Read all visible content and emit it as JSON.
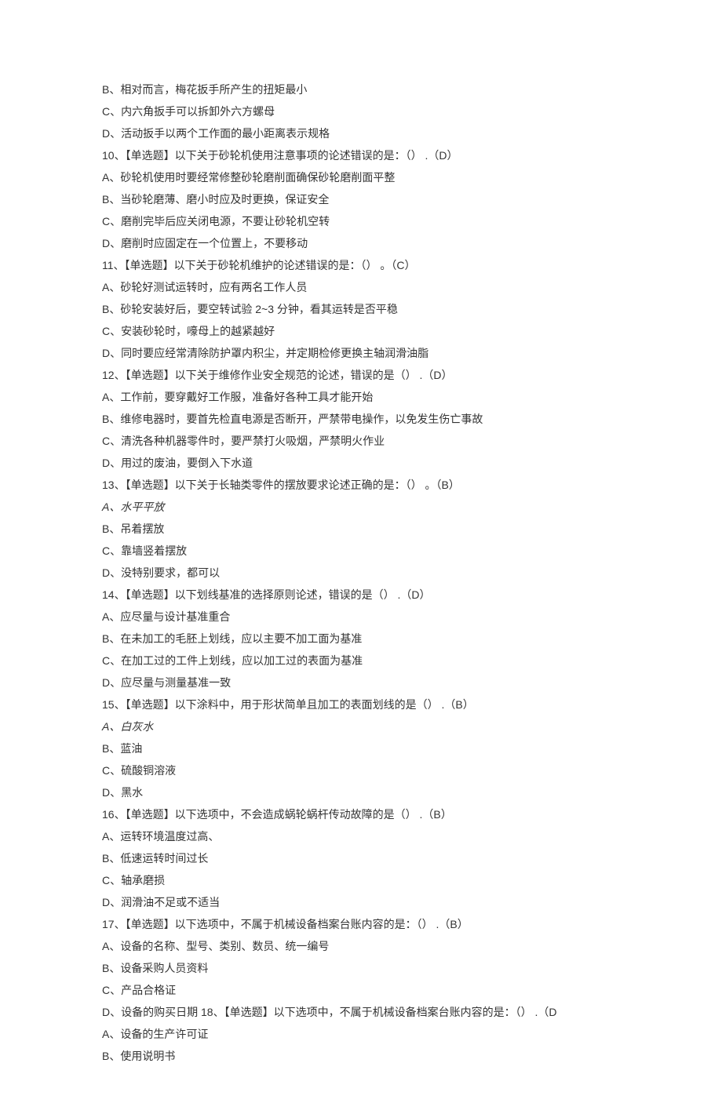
{
  "lines": [
    {
      "text": "B、相对而言，梅花扳手所产生的扭矩最小"
    },
    {
      "text": "C、内六角扳手可以拆卸外六方螺母"
    },
    {
      "text": "D、活动扳手以两个工作面的最小距离表示规格"
    },
    {
      "text": "10、【单选题】以下关于砂轮机使用注意事项的论述错误的是：（） .（D）"
    },
    {
      "text": "A、砂轮机使用时要经常修整砂轮磨削面确保砂轮磨削面平整"
    },
    {
      "text": "B、当砂轮磨薄、磨小时应及时更换，保证安全"
    },
    {
      "text": "C、磨削完毕后应关闭电源，不要让砂轮机空转"
    },
    {
      "text": "D、磨削时应固定在一个位置上，不要移动"
    },
    {
      "text": "11、【单选题】以下关于砂轮机维护的论述错误的是：（） 。（C）"
    },
    {
      "text": "A、砂轮好测试运转时，应有两名工作人员"
    },
    {
      "text": "B、砂轮安装好后，要空转试验 2~3 分钟，看其运转是否平稳"
    },
    {
      "text": "C、安装砂轮时，嚎母上的越紧越好"
    },
    {
      "text": "D、同时要应经常清除防护罩内积尘，并定期检修更换主轴润滑油脂"
    },
    {
      "text": "12、【单选题】以下关于维修作业安全规范的论述，错误的是（） .（D）"
    },
    {
      "text": "A、工作前，要穿戴好工作服，准备好各种工具才能开始"
    },
    {
      "text": "B、维修电器时，要首先检直电源是否断开，严禁带电操作，以免发生伤亡事故"
    },
    {
      "text": "C、清洗各种机器零件时，要严禁打火吸烟，严禁明火作业"
    },
    {
      "text": "D、用过的废油，要倒入下水道"
    },
    {
      "text": "13、【单选题】以下关于长轴类零件的摆放要求论述正确的是：（） 。（B）"
    },
    {
      "text": "A、水平平放",
      "italic": true
    },
    {
      "text": "B、吊着摆放"
    },
    {
      "text": "C、靠墙竖着摆放"
    },
    {
      "text": "D、没特别要求，都可以"
    },
    {
      "text": "14、【单选题】以下划线基准的选择原则论述，错误的是（） .（D）"
    },
    {
      "text": "A、应尽量与设计基准重合"
    },
    {
      "text": "B、在未加工的毛胚上划线，应以主要不加工面为基准"
    },
    {
      "text": "C、在加工过的工件上划线，应以加工过的表面为基准"
    },
    {
      "text": "D、应尽量与测量基准一致"
    },
    {
      "text": "15、【单选题】以下涂料中，用于形状简单且加工的表面划线的是（） .（B）"
    },
    {
      "text": "A、白灰水",
      "italic": true
    },
    {
      "text": "B、蓝油"
    },
    {
      "text": "C、硫酸铜溶液"
    },
    {
      "text": "D、黑水"
    },
    {
      "text": "16、【单选题】以下选项中，不会造成蜗轮蜗杆传动故障的是（） .（B）"
    },
    {
      "text": "A、运转环境温度过高、"
    },
    {
      "text": "B、低速运转时间过长"
    },
    {
      "text": "C、轴承磨损"
    },
    {
      "text": "D、润滑油不足或不适当"
    },
    {
      "text": "17、【单选题】以下选项中，不属于机械设备档案台账内容的是：（） .（B）"
    },
    {
      "text": "A、设备的名称、型号、类别、数员、统一编号"
    },
    {
      "text": "B、设备采购人员资料"
    },
    {
      "text": "C、产品合格证"
    },
    {
      "text": "D、设备的购买日期 18、【单选题】以下选项中，不属于机械设备档案台账内容的是：（） .（D"
    },
    {
      "text": "A、设备的生产许可证"
    },
    {
      "text": "B、使用说明书"
    }
  ]
}
